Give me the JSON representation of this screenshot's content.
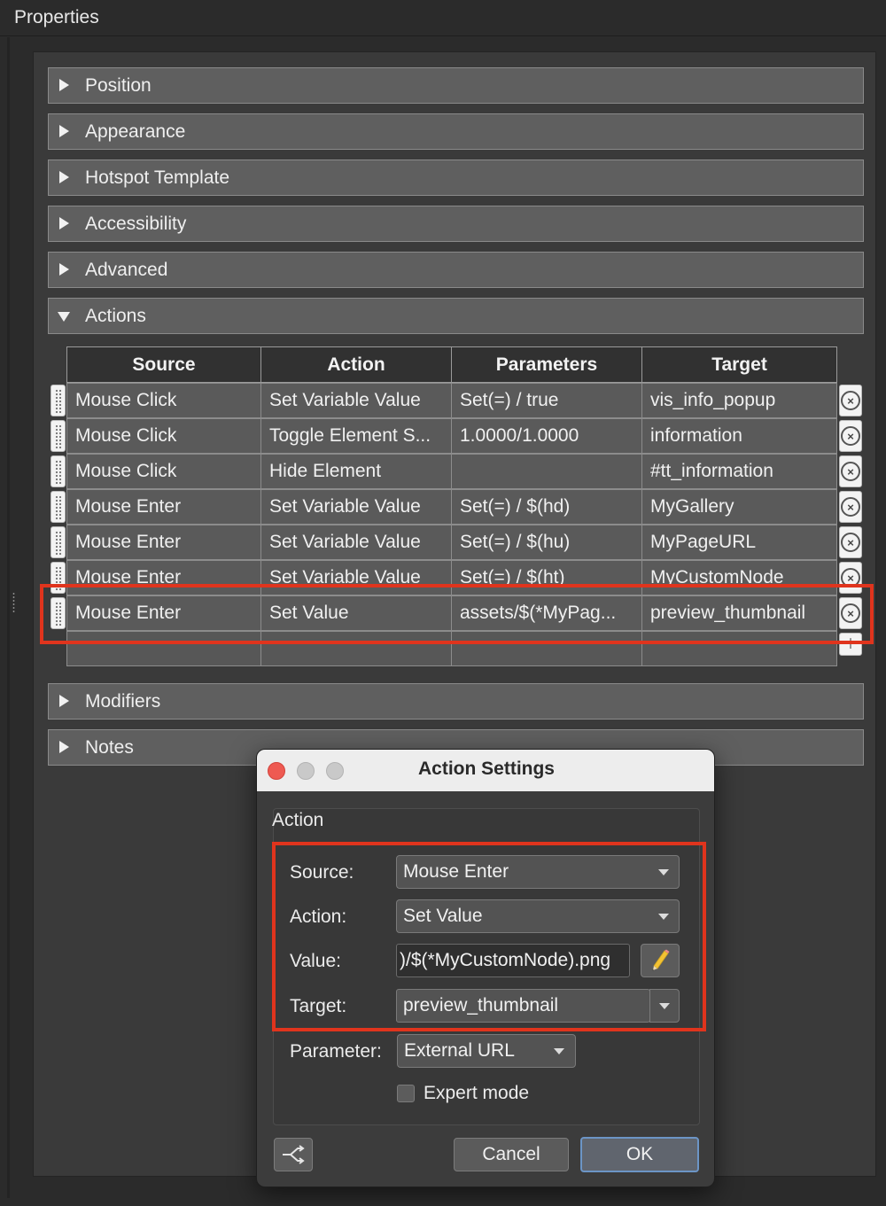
{
  "panel": {
    "title": "Properties"
  },
  "sections": [
    {
      "label": "Position",
      "expanded": false
    },
    {
      "label": "Appearance",
      "expanded": false
    },
    {
      "label": "Hotspot Template",
      "expanded": false
    },
    {
      "label": "Accessibility",
      "expanded": false
    },
    {
      "label": "Advanced",
      "expanded": false
    },
    {
      "label": "Actions",
      "expanded": true
    },
    {
      "label": "Modifiers",
      "expanded": false
    },
    {
      "label": "Notes",
      "expanded": false
    }
  ],
  "actions_table": {
    "columns": [
      "Source",
      "Action",
      "Parameters",
      "Target"
    ],
    "rows": [
      [
        "Mouse Click",
        "Set Variable Value",
        "Set(=) / true",
        "vis_info_popup"
      ],
      [
        "Mouse Click",
        "Toggle Element S...",
        "1.0000/1.0000",
        "information"
      ],
      [
        "Mouse Click",
        "Hide Element",
        "",
        "#tt_information"
      ],
      [
        "Mouse Enter",
        "Set Variable Value",
        "Set(=) / $(hd)",
        "MyGallery"
      ],
      [
        "Mouse Enter",
        "Set Variable Value",
        "Set(=) / $(hu)",
        "MyPageURL"
      ],
      [
        "Mouse Enter",
        "Set Variable Value",
        "Set(=) / $(ht)",
        "MyCustomNode"
      ],
      [
        "Mouse Enter",
        "Set Value",
        "assets/$(*MyPag...",
        "preview_thumbnail"
      ]
    ],
    "highlighted_row": 6,
    "highlight_color": "#e0341d"
  },
  "dialog": {
    "title": "Action Settings",
    "group_title": "Action",
    "source_label": "Source:",
    "source_value": "Mouse Enter",
    "action_label": "Action:",
    "action_value": "Set Value",
    "value_label": "Value:",
    "value_text": ")/$(*MyCustomNode).png",
    "target_label": "Target:",
    "target_value": "preview_thumbnail",
    "parameter_label": "Parameter:",
    "parameter_value": "External URL",
    "expert_mode_label": "Expert mode",
    "expert_mode_checked": false,
    "cancel_label": "Cancel",
    "ok_label": "OK",
    "window_controls": [
      "close",
      "minimize",
      "zoom"
    ],
    "icons": {
      "edit": "pencil-icon",
      "share": "share-icon"
    }
  }
}
